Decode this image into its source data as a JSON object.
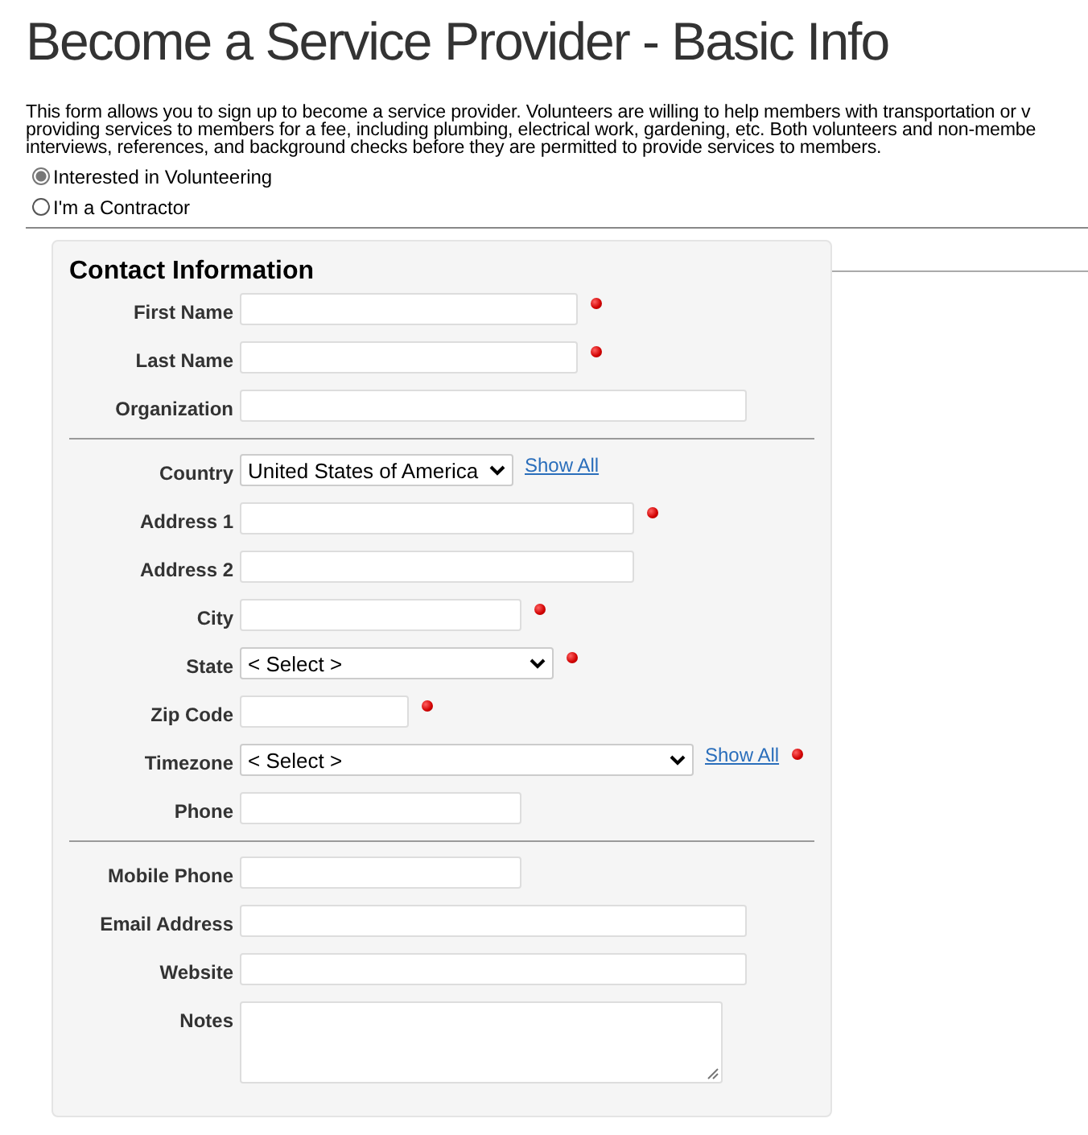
{
  "title": "Become a Service Provider - Basic Info",
  "intro_lines": [
    "This form allows you to sign up to become a service provider. Volunteers are willing to help members with transportation or v",
    "providing services to members for a fee, including plumbing, electrical work, gardening, etc. Both volunteers and non-membe",
    "interviews, references, and background checks before they are permitted to provide services to members."
  ],
  "options": [
    {
      "label": "Interested in Volunteering",
      "selected": true
    },
    {
      "label": "I'm a Contractor",
      "selected": false
    }
  ],
  "section": {
    "title": "Contact Information",
    "groups": [
      [
        {
          "label": "First Name",
          "kind": "text",
          "required": true
        },
        {
          "label": "Last Name",
          "kind": "text",
          "required": true
        },
        {
          "label": "Organization",
          "kind": "text",
          "required": false
        }
      ],
      [
        {
          "label": "Country",
          "kind": "select",
          "value": "United States of America",
          "link": "Show All",
          "required": false
        },
        {
          "label": "Address 1",
          "kind": "text",
          "required": true
        },
        {
          "label": "Address 2",
          "kind": "text",
          "required": false
        },
        {
          "label": "City",
          "kind": "text",
          "required": true
        },
        {
          "label": "State",
          "kind": "select",
          "value": "< Select >",
          "required": true
        },
        {
          "label": "Zip Code",
          "kind": "text",
          "required": true
        },
        {
          "label": "Timezone",
          "kind": "select",
          "value": "< Select >",
          "link": "Show All",
          "required": true
        },
        {
          "label": "Phone",
          "kind": "text",
          "required": false
        }
      ],
      [
        {
          "label": "Mobile Phone",
          "kind": "text",
          "required": false
        },
        {
          "label": "Email Address",
          "kind": "text",
          "required": false
        },
        {
          "label": "Website",
          "kind": "text",
          "required": false
        },
        {
          "label": "Notes",
          "kind": "textarea",
          "required": false
        }
      ]
    ]
  }
}
